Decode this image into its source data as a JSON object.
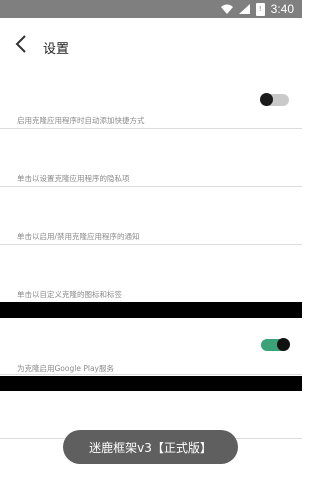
{
  "statusbar": {
    "time": "3:40",
    "battery_icon": "battery-icon"
  },
  "header": {
    "title": "设置",
    "back_icon": "chevron-left-icon"
  },
  "settings": [
    {
      "label": "启用克隆应用程序时自动添加快捷方式",
      "toggle": "off"
    },
    {
      "label": "单击以设置克隆应用程序的隐私项"
    },
    {
      "label": "单击以启用/禁用克隆应用程序的通知"
    },
    {
      "label": "单击以自定义克隆的图标和标签"
    },
    {
      "label": "为克隆启用Google Play服务",
      "toggle": "on"
    }
  ],
  "toast": {
    "text": "迷鹿框架v3【正式版】"
  },
  "colors": {
    "accent": "#3aa178",
    "statusbar": "#7f7f7f",
    "toast": "#5f5f5f"
  }
}
